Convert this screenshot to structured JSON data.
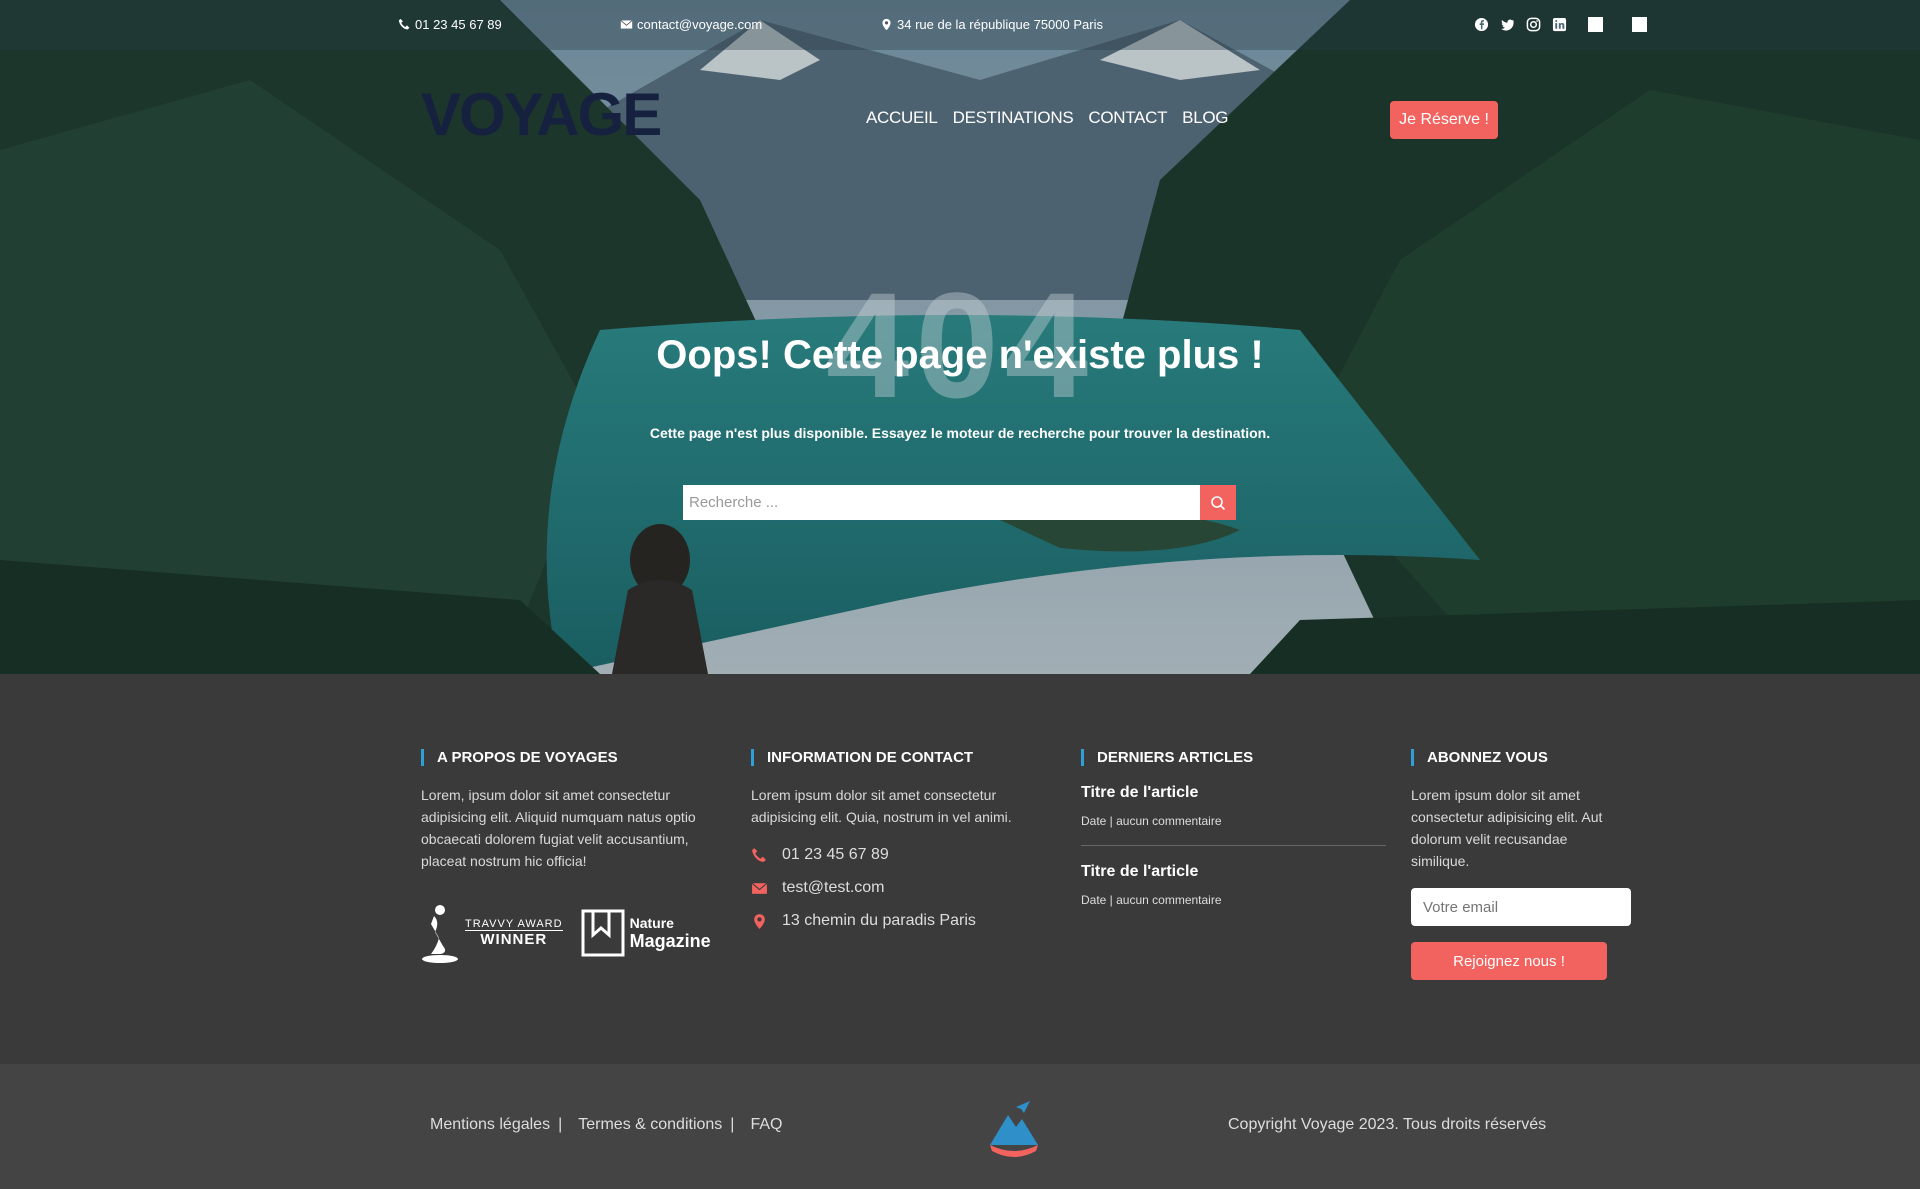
{
  "topbar": {
    "phone": "01 23 45 67 89",
    "email": "contact@voyage.com",
    "address": "34 rue de la république 75000 Paris",
    "socials": [
      "facebook-icon",
      "twitter-icon",
      "instagram-icon",
      "linkedin-icon"
    ]
  },
  "header": {
    "logo": "VOYAGE",
    "nav": [
      "ACCUEIL",
      "DESTINATIONS",
      "CONTACT",
      "BLOG"
    ],
    "reserve": "Je Réserve !"
  },
  "error": {
    "code": "404",
    "title": "Oops! Cette page n'existe plus !",
    "subtitle": "Cette page n'est plus disponible. Essayez le moteur de recherche pour trouver la destination.",
    "search_placeholder": "Recherche ..."
  },
  "footer": {
    "about": {
      "title": "A PROPOS DE VOYAGES",
      "text": "Lorem, ipsum dolor sit amet consectetur adipisicing elit. Aliquid numquam natus optio obcaecati dolorem fugiat velit accusantium, placeat nostrum hic officia!",
      "award1_small": "TRAVVY AWARD",
      "award1_big": "WINNER",
      "award2_small": "Nature",
      "award2_big": "Magazine"
    },
    "contact": {
      "title": "INFORMATION DE CONTACT",
      "text": "Lorem ipsum dolor sit amet consectetur adipisicing elit. Quia, nostrum in vel animi.",
      "phone": "01 23 45 67 89",
      "email": "test@test.com",
      "address": "13 chemin du paradis Paris"
    },
    "articles": {
      "title": "DERNIERS ARTICLES",
      "items": [
        {
          "title": "Titre de l'article",
          "meta": "Date | aucun commentaire"
        },
        {
          "title": "Titre de l'article",
          "meta": "Date | aucun commentaire"
        }
      ]
    },
    "subscribe": {
      "title": "ABONNEZ VOUS",
      "text": "Lorem ipsum dolor sit amet consectetur adipisicing elit. Aut dolorum velit recusandae similique.",
      "email_placeholder": "Votre email",
      "button": "Rejoignez nous !"
    }
  },
  "bottom": {
    "links": [
      "Mentions légales",
      "Termes & conditions",
      "FAQ"
    ],
    "copyright": "Copyright Voyage 2023. Tous droits réservés"
  },
  "colors": {
    "accent": "#f2625e",
    "footer_bg": "#3a3a3a",
    "heading_bar": "#2f9fd8"
  }
}
